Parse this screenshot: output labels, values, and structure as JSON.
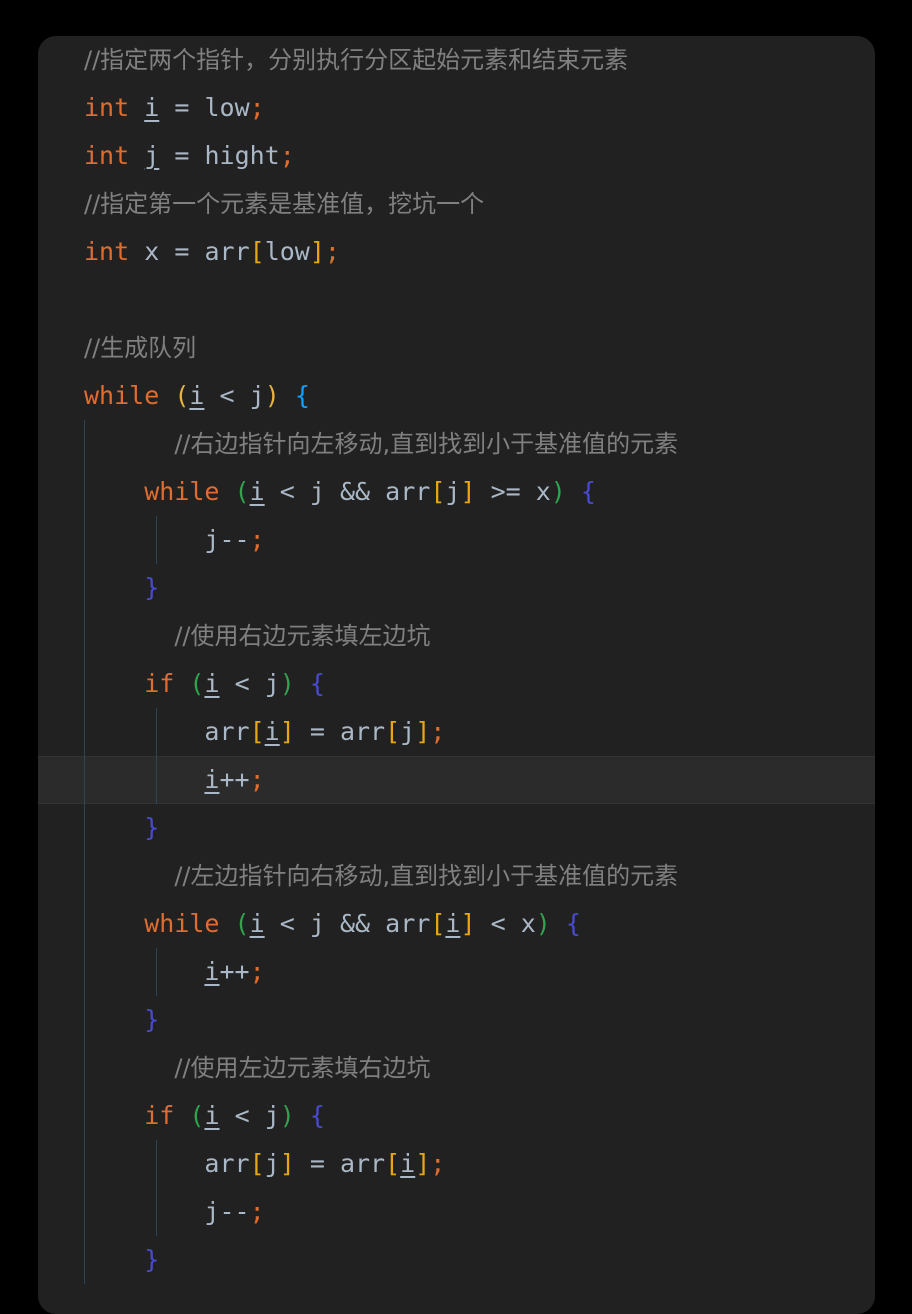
{
  "window": {
    "background_color": "#000000",
    "card_background": "#212121",
    "highlight_line_color": "#2b2b2b",
    "indent_guide_color": "#2f4554"
  },
  "theme": {
    "comment": "#808080",
    "keyword": "#e06c2f",
    "identifier": "#a9b7c6",
    "semicolon": "#e06c2f",
    "paren_level_yellow": "#e8b33a",
    "paren_level_green": "#2da44e",
    "brace_level_cyan": "#0fa0ff",
    "brace_level_indigo": "#4a4ad1",
    "bracket_yellow": "#e8a712"
  },
  "editor": {
    "language": "java",
    "highlighted_line_index": 16,
    "lines": [
      {
        "id": "line-1",
        "indent": 0,
        "kind": "comment",
        "text": "//指定两个指针，分别执行分区起始元素和结束元素"
      },
      {
        "id": "line-2",
        "indent": 0,
        "kind": "code",
        "text": "int i = low;"
      },
      {
        "id": "line-3",
        "indent": 0,
        "kind": "code",
        "text": "int j = hight;"
      },
      {
        "id": "line-4",
        "indent": 0,
        "kind": "comment",
        "text": "//指定第一个元素是基准值，挖坑一个"
      },
      {
        "id": "line-5",
        "indent": 0,
        "kind": "code",
        "text": "int x = arr[low];"
      },
      {
        "id": "line-6",
        "indent": 0,
        "kind": "blank",
        "text": ""
      },
      {
        "id": "line-7",
        "indent": 0,
        "kind": "comment",
        "text": "//生成队列"
      },
      {
        "id": "line-8",
        "indent": 0,
        "kind": "code",
        "text": "while (i < j) {"
      },
      {
        "id": "line-9",
        "indent": 1,
        "kind": "comment",
        "text": "//右边指针向左移动,直到找到小于基准值的元素"
      },
      {
        "id": "line-10",
        "indent": 1,
        "kind": "code",
        "text": "while (i < j && arr[j] >= x) {"
      },
      {
        "id": "line-11",
        "indent": 2,
        "kind": "code",
        "text": "j--;"
      },
      {
        "id": "line-12",
        "indent": 1,
        "kind": "code",
        "text": "}"
      },
      {
        "id": "line-13",
        "indent": 1,
        "kind": "comment",
        "text": "//使用右边元素填左边坑"
      },
      {
        "id": "line-14",
        "indent": 1,
        "kind": "code",
        "text": "if (i < j) {"
      },
      {
        "id": "line-15",
        "indent": 2,
        "kind": "code",
        "text": "arr[i] = arr[j];"
      },
      {
        "id": "line-16",
        "indent": 2,
        "kind": "code",
        "text": "i++;"
      },
      {
        "id": "line-17",
        "indent": 1,
        "kind": "code",
        "text": "}"
      },
      {
        "id": "line-18",
        "indent": 1,
        "kind": "comment",
        "text": "//左边指针向右移动,直到找到小于基准值的元素"
      },
      {
        "id": "line-19",
        "indent": 1,
        "kind": "code",
        "text": "while (i < j && arr[i] < x) {"
      },
      {
        "id": "line-20",
        "indent": 2,
        "kind": "code",
        "text": "i++;"
      },
      {
        "id": "line-21",
        "indent": 1,
        "kind": "code",
        "text": "}"
      },
      {
        "id": "line-22",
        "indent": 1,
        "kind": "comment",
        "text": "//使用左边元素填右边坑"
      },
      {
        "id": "line-23",
        "indent": 1,
        "kind": "code",
        "text": "if (i < j) {"
      },
      {
        "id": "line-24",
        "indent": 2,
        "kind": "code",
        "text": "arr[j] = arr[i];"
      },
      {
        "id": "line-25",
        "indent": 2,
        "kind": "code",
        "text": "j--;"
      },
      {
        "id": "line-26",
        "indent": 1,
        "kind": "code",
        "text": "}"
      }
    ],
    "tokens": {
      "kw_int": "int",
      "kw_while": "while",
      "kw_if": "if",
      "id_i": "i",
      "id_j": "j",
      "id_x": "x",
      "id_low": "low",
      "id_hight": "hight",
      "id_arr": "arr",
      "op_assign": "=",
      "op_lt": "<",
      "op_gte": ">=",
      "op_and": "&&",
      "op_inc": "++",
      "op_dec": "--",
      "semicolon": ";",
      "paren_open": "(",
      "paren_close": ")",
      "brace_open": "{",
      "brace_close": "}",
      "bracket_open": "[",
      "bracket_close": "]"
    }
  }
}
